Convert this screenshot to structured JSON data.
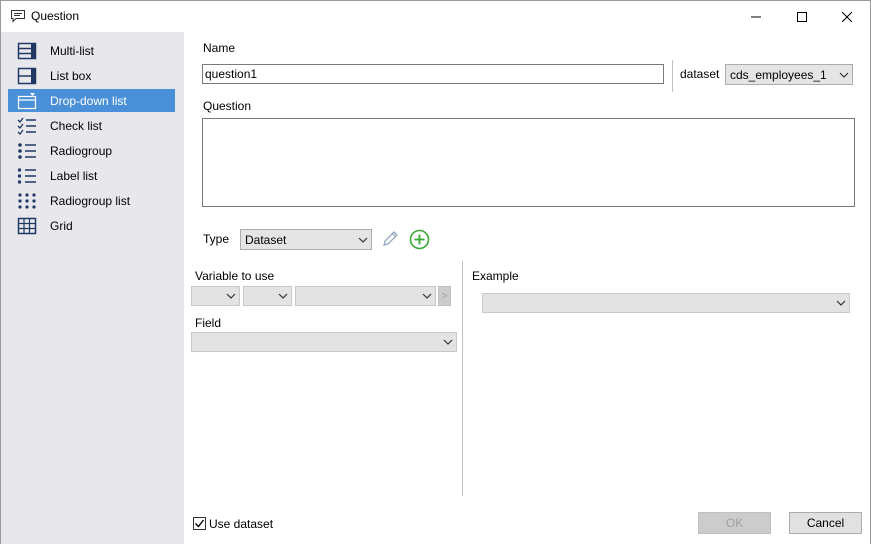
{
  "window": {
    "title": "Question",
    "minimize_icon": "minimize-icon",
    "maximize_icon": "maximize-icon",
    "close_icon": "close-icon"
  },
  "sidebar": {
    "items": [
      {
        "label": "Multi-list",
        "icon": "multi-list-icon",
        "selected": false
      },
      {
        "label": "List box",
        "icon": "list-box-icon",
        "selected": false
      },
      {
        "label": "Drop-down list",
        "icon": "drop-down-list-icon",
        "selected": true
      },
      {
        "label": "Check list",
        "icon": "check-list-icon",
        "selected": false
      },
      {
        "label": "Radiogroup",
        "icon": "radiogroup-icon",
        "selected": false
      },
      {
        "label": "Label list",
        "icon": "label-list-icon",
        "selected": false
      },
      {
        "label": "Radiogroup list",
        "icon": "radiogroup-list-icon",
        "selected": false
      },
      {
        "label": "Grid",
        "icon": "grid-icon",
        "selected": false
      }
    ]
  },
  "form": {
    "name_label": "Name",
    "name_value": "question1",
    "dataset_label": "dataset",
    "dataset_value": "cds_employees_1",
    "question_label": "Question",
    "question_value": "",
    "type_label": "Type",
    "type_value": "Dataset",
    "variable_label": "Variable to use",
    "variable_btn": ">",
    "field_label": "Field",
    "example_label": "Example",
    "use_dataset_label": "Use dataset",
    "use_dataset_checked": true
  },
  "buttons": {
    "ok": "OK",
    "cancel": "Cancel"
  },
  "colors": {
    "selection": "#4a90d9",
    "sidebar_bg": "#e8e8ec",
    "add_green": "#3aa935"
  }
}
